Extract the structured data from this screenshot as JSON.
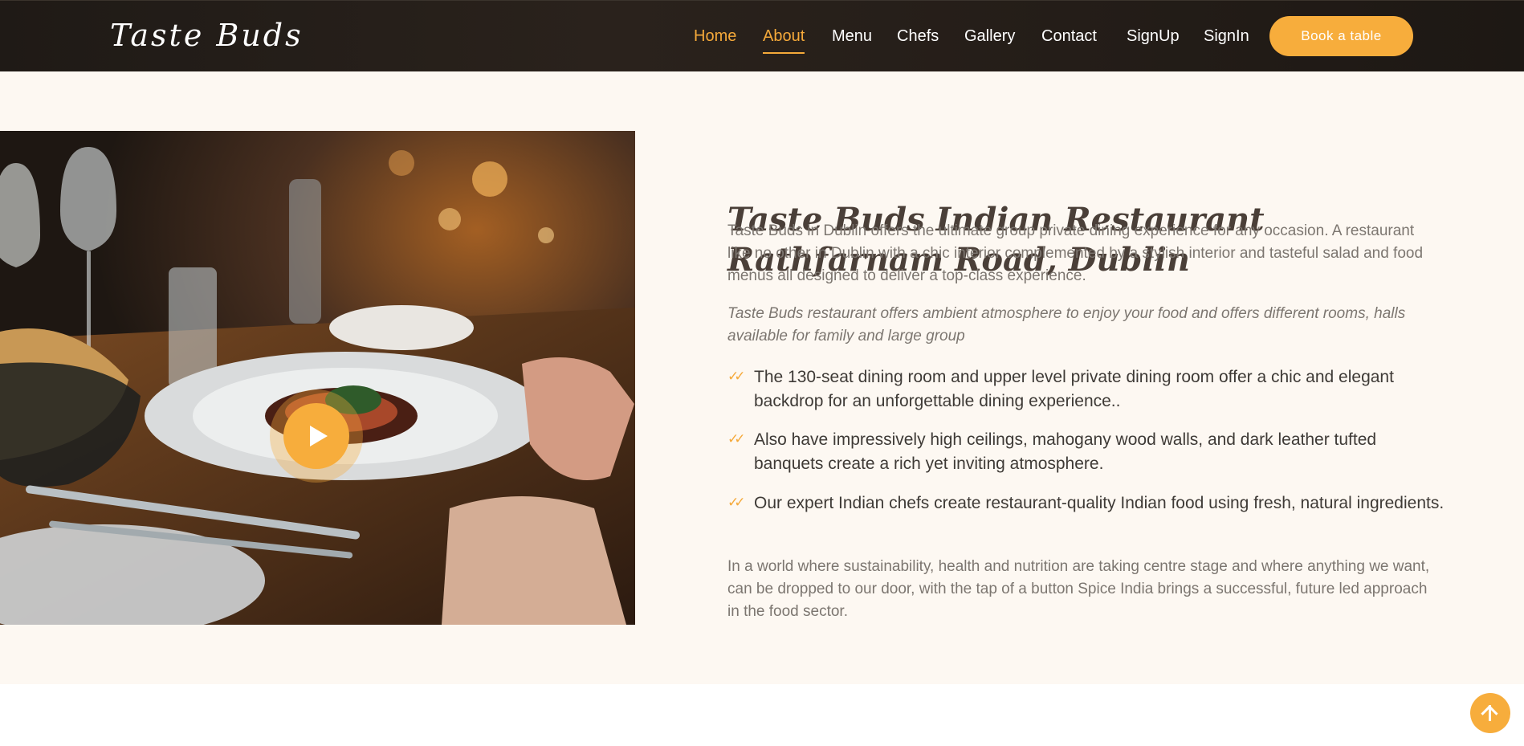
{
  "header": {
    "logo": "Taste Buds",
    "nav": [
      "Home",
      "About",
      "Menu",
      "Chefs",
      "Gallery",
      "Contact",
      "SignUp",
      "SignIn"
    ],
    "book_button": "Book a table"
  },
  "about": {
    "title_bold": "Taste Buds",
    "title_rest": " Indian Restaurant Rathfarnam Road, Dublin",
    "intro": "Taste Buds in Dublin offers the ultimate group private dining experience for any occasion. A restaurant like no other in Dublin with a chic interior complemented by a stylish interior and tasteful salad and food menus all designed to deliver a top-class experience.",
    "italic_note": "Taste Buds restaurant offers ambient atmosphere to enjoy your food and offers different rooms, halls available for family and large group",
    "bullets": [
      "The 130-seat dining room and upper level private dining room offer a chic and elegant backdrop for an unforgettable dining experience..",
      "Also have impressively high ceilings, mahogany wood walls, and dark leather tufted banquets create a rich yet inviting atmosphere.",
      "Our expert Indian chefs create restaurant-quality Indian food using fresh, natural ingredients."
    ],
    "closing": "In a world where sustainability, health and nutrition are taking centre stage and where anything we want, can be dropped to our door, with the tap of a button Spice India brings a successful, future led approach in the food sector."
  },
  "icons": {
    "play": "play-icon",
    "check": "double-check-icon",
    "scroll_top": "arrow-up-icon"
  },
  "colors": {
    "accent": "#f7ad3c",
    "header_bg": "#241d18",
    "section_bg": "#fdf8f2"
  }
}
